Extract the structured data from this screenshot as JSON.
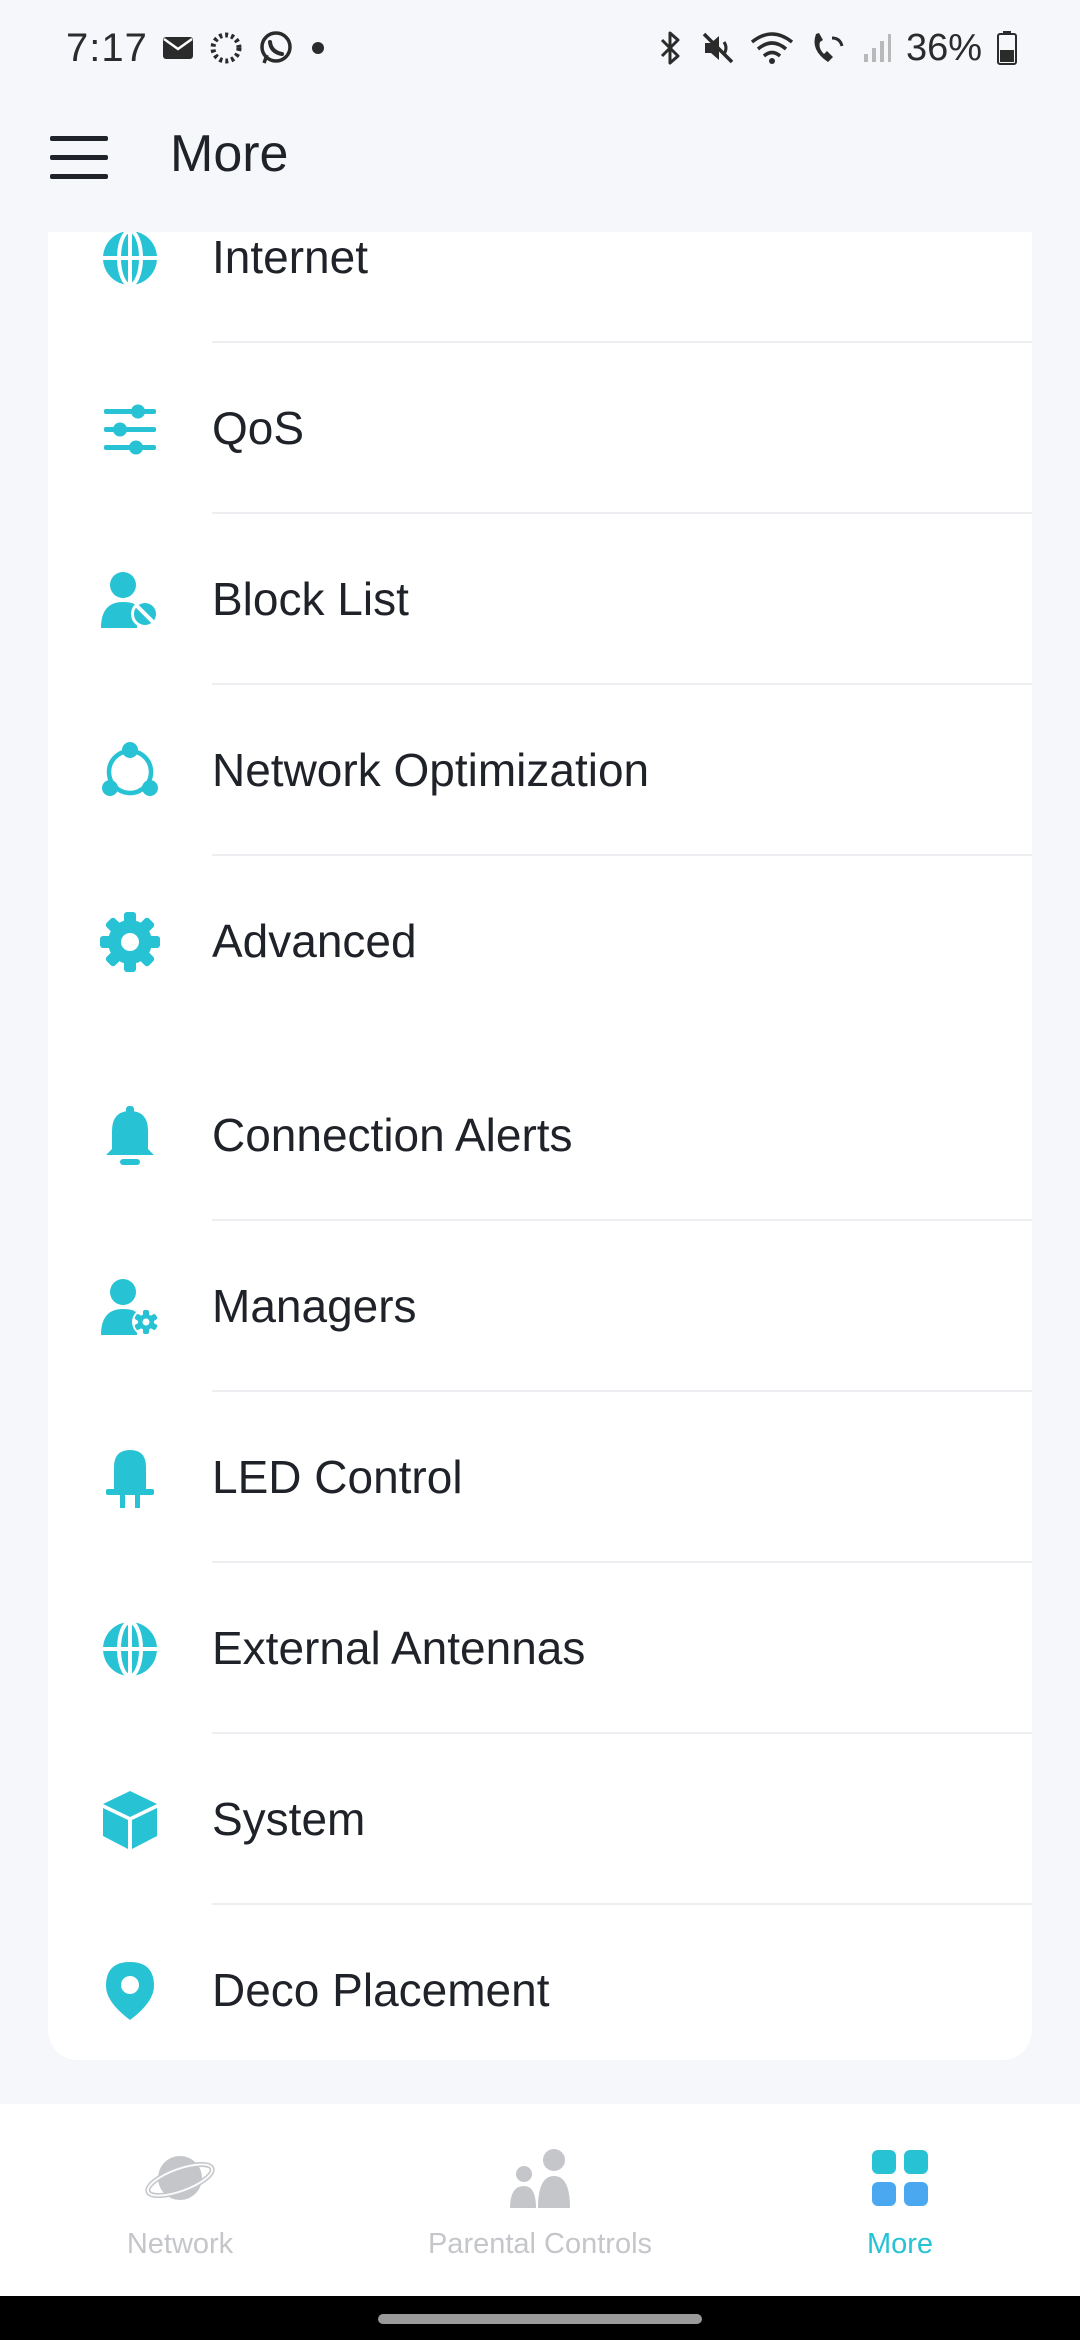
{
  "status_bar": {
    "time": "7:17",
    "battery": "36%"
  },
  "header": {
    "title": "More"
  },
  "colors": {
    "accent": "#27c2d4",
    "inactive": "#c4c6ca"
  },
  "sections": [
    {
      "items": [
        {
          "label": "Internet",
          "icon": "globe-icon"
        },
        {
          "label": "QoS",
          "icon": "sliders-icon"
        },
        {
          "label": "Block List",
          "icon": "user-block-icon"
        },
        {
          "label": "Network Optimization",
          "icon": "network-nodes-icon"
        },
        {
          "label": "Advanced",
          "icon": "gear-icon"
        }
      ]
    },
    {
      "items": [
        {
          "label": "Connection Alerts",
          "icon": "bell-icon"
        },
        {
          "label": "Managers",
          "icon": "user-gear-icon"
        },
        {
          "label": "LED Control",
          "icon": "led-icon"
        },
        {
          "label": "External Antennas",
          "icon": "globe-icon"
        },
        {
          "label": "System",
          "icon": "cube-icon"
        },
        {
          "label": "Deco Placement",
          "icon": "location-pin-icon"
        }
      ]
    }
  ],
  "bottom_nav": {
    "items": [
      {
        "label": "Network",
        "icon": "planet-icon",
        "active": false
      },
      {
        "label": "Parental Controls",
        "icon": "family-icon",
        "active": false
      },
      {
        "label": "More",
        "icon": "grid-icon",
        "active": true
      }
    ]
  }
}
